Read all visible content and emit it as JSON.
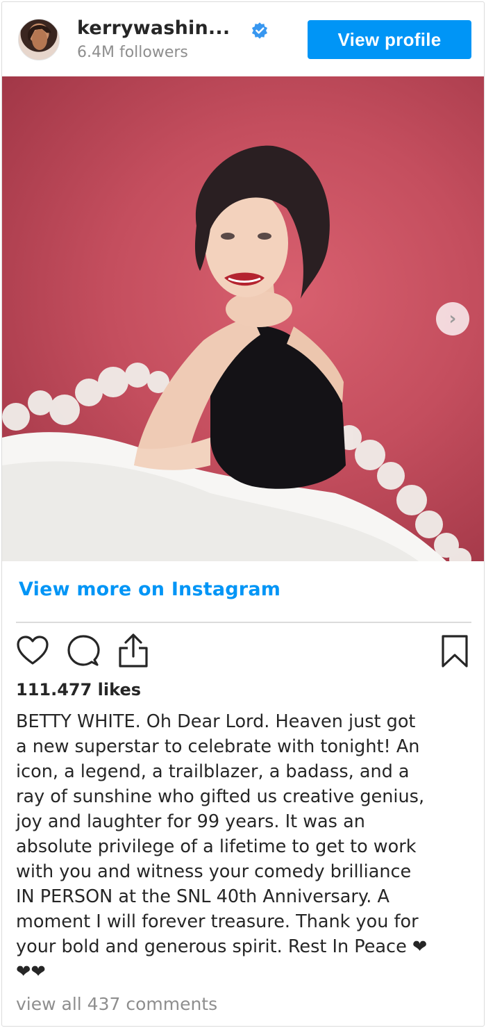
{
  "header": {
    "username": "kerrywashin...",
    "followers": "6.4M followers",
    "view_profile_label": "View profile"
  },
  "post": {
    "next_arrow": "›",
    "view_more_label": "View more on Instagram",
    "likes": "111.477 likes",
    "caption": "BETTY WHITE. Oh Dear Lord. Heaven just got\na new superstar to celebrate with tonight! An\nicon, a legend, a trailblazer, a badass, and a\nray of sunshine who gifted us creative genius,\njoy and laughter for 99 years. It was an\nabsolute privilege of a lifetime to get to work\nwith you and witness your comedy brilliance\nIN PERSON at the SNL 40th Anniversary. A\nmoment I will forever treasure. Thank you for\nyour bold and generous spirit. Rest In Peace ❤\n❤❤",
    "comments_link": "view all 437 comments"
  },
  "icons": {
    "verified": "verified-badge-icon",
    "like": "heart-icon",
    "comment": "comment-bubble-icon",
    "share": "share-icon",
    "save": "bookmark-icon",
    "next": "chevron-right-icon"
  },
  "colors": {
    "accent": "#0095f6",
    "text": "#262626",
    "muted": "#8e8e8e",
    "photo_background": "#c44e5e"
  }
}
